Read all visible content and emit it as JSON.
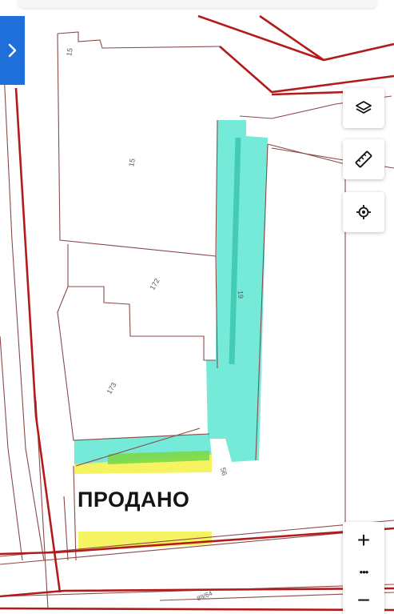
{
  "map": {
    "parcel_labels": [
      "15",
      "15",
      "172",
      "173",
      "19",
      "56"
    ],
    "road_label": "89/64",
    "annotation": "ПРОДАНО",
    "colors": {
      "boundary_red": "#b31b1b",
      "parcel_line": "#8a4a4a",
      "highlight_cyan": "#5ee6d2",
      "highlight_yellow": "#f5f25a",
      "highlight_green": "#7cd94a",
      "control_blue": "#1e6fd9"
    }
  },
  "controls": {
    "panel_toggle_icon": "chevron-right-icon",
    "layers_icon": "layers-icon",
    "ruler_icon": "ruler-icon",
    "locate_icon": "crosshair-icon",
    "zoom_in": "+",
    "more": "•••",
    "zoom_out": "−"
  }
}
